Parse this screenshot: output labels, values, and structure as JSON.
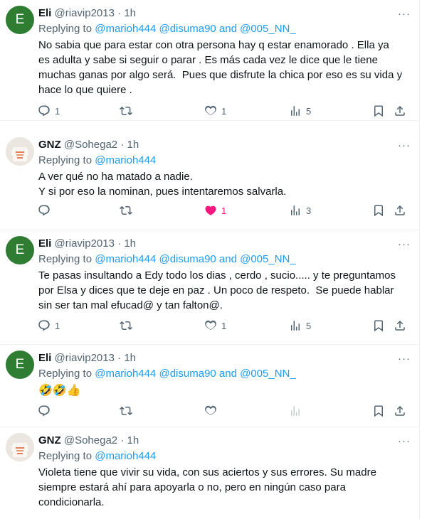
{
  "tweets": [
    {
      "avatar_letter": "E",
      "name": "Eli",
      "handle": "@riavip2013",
      "dot": "·",
      "time": "1h",
      "replying_prefix": "Replying to ",
      "replying_users": "@marioh444 @disuma90 and @005_NN_",
      "text": "No sabia que para estar con otra persona hay q estar enamorado . Ella ya\nes adulta y sabe si seguir o parar . Es más cada vez le dice que le tiene\nmuchas ganas por algo será.  Pues que disfrute la chica por eso es su vida y\nhace lo que quiere .",
      "reply_count": "1",
      "retweet_count": "",
      "like_count": "1",
      "view_count": "5"
    },
    {
      "avatar_letter": "",
      "name": "GNZ",
      "handle": "@Sohega2",
      "dot": "·",
      "time": "1h",
      "replying_prefix": "Replying to ",
      "replying_users": "@marioh444",
      "text": "A ver qué no ha matado a nadie.\nY si por eso la nominan, pues intentaremos salvarla.",
      "reply_count": "",
      "retweet_count": "",
      "like_count": "1",
      "view_count": "3"
    },
    {
      "avatar_letter": "E",
      "name": "Eli",
      "handle": "@riavip2013",
      "dot": "·",
      "time": "1h",
      "replying_prefix": "Replying to ",
      "replying_users": "@marioh444 @disuma90 and @005_NN_",
      "text": "Te pasas insultando a Edy todo los dias , cerdo , sucio..... y te preguntamos\npor Elsa y dices que te deje en paz . Un poco de respeto.  Se puede hablar\nsin ser tan mal efucad@ y tan falton@.",
      "reply_count": "1",
      "retweet_count": "",
      "like_count": "1",
      "view_count": "5"
    },
    {
      "avatar_letter": "E",
      "name": "Eli",
      "handle": "@riavip2013",
      "dot": "·",
      "time": "1h",
      "replying_prefix": "Replying to ",
      "replying_users": "@marioh444 @disuma90 and @005_NN_",
      "text": "🤣🤣👍",
      "reply_count": "",
      "retweet_count": "",
      "like_count": "",
      "view_count": ""
    },
    {
      "avatar_letter": "",
      "name": "GNZ",
      "handle": "@Sohega2",
      "dot": "·",
      "time": "1h",
      "replying_prefix": "Replying to ",
      "replying_users": "@marioh444",
      "text": "Violeta tiene que vivir su vida, con sus aciertos y sus errores. Su madre\nsiempre estará ahí para apoyarla o no, pero en ningún caso para\ncondicionarla.",
      "reply_count": "",
      "retweet_count": "",
      "like_count": "",
      "view_count": ""
    }
  ],
  "more_glyph": "···",
  "colors": {
    "link": "#1d9bf0",
    "muted": "#536471",
    "like_active": "#f91880",
    "avatar_e": "#2e7d32"
  },
  "icons": [
    "reply-icon",
    "retweet-icon",
    "like-icon",
    "views-icon",
    "bookmark-icon",
    "share-icon",
    "more-icon"
  ]
}
